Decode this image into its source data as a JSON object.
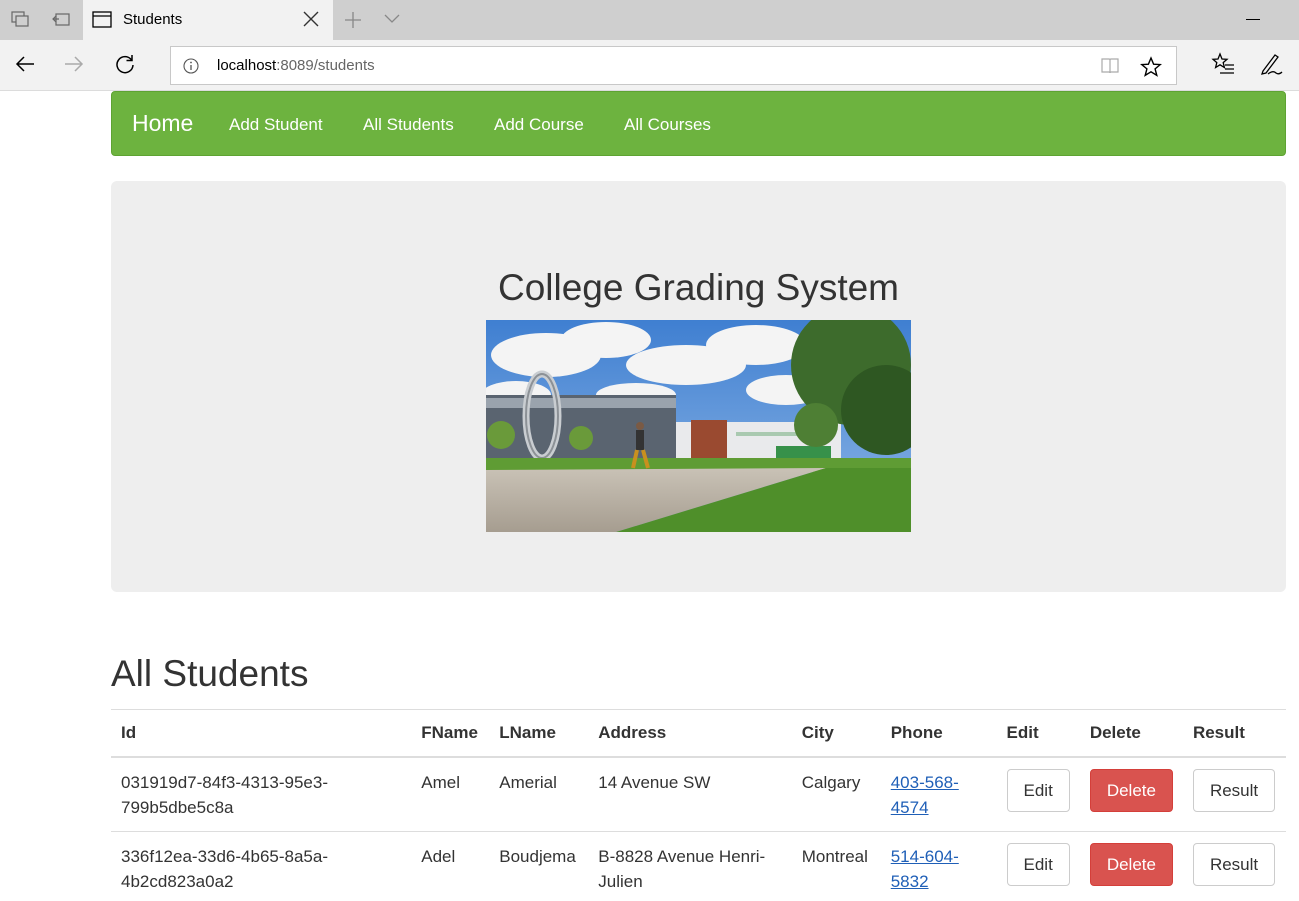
{
  "browser": {
    "tab_title": "Students",
    "url_host": "localhost",
    "url_path": ":8089/students"
  },
  "navbar": {
    "brand": "Home",
    "links": [
      "Add Student",
      "All Students",
      "Add Course",
      "All Courses"
    ],
    "color": "#6db33f"
  },
  "jumbotron": {
    "title": "College Grading System"
  },
  "students": {
    "title": "All Students",
    "columns": [
      "Id",
      "FName",
      "LName",
      "Address",
      "City",
      "Phone",
      "Edit",
      "Delete",
      "Result"
    ],
    "rows": [
      {
        "id_line1": "031919d7-84f3-4313-95e3-",
        "id_line2": "799b5dbe5c8a",
        "fname": "Amel",
        "lname": "Amerial",
        "address_line1": "14 Avenue SW",
        "address_line2": "",
        "city": "Calgary",
        "phone_line1": "403-568-",
        "phone_line2": "4574",
        "edit": "Edit",
        "delete": "Delete",
        "result": "Result"
      },
      {
        "id_line1": "336f12ea-33d6-4b65-8a5a-",
        "id_line2": "4b2cd823a0a2",
        "fname": "Adel",
        "lname": "Boudjema",
        "address_line1": "B-8828 Avenue Henri-",
        "address_line2": "Julien",
        "city": "Montreal",
        "phone_line1": "514-604-",
        "phone_line2": "5832",
        "edit": "Edit",
        "delete": "Delete",
        "result": "Result"
      }
    ],
    "delete_color": "#d9534f"
  }
}
